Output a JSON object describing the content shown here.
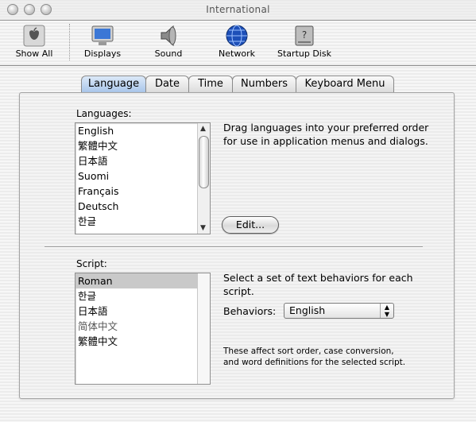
{
  "window": {
    "title": "International"
  },
  "toolbar": {
    "items": [
      {
        "label": "Show All",
        "icon": "apple-logo-icon"
      },
      {
        "label": "Displays",
        "icon": "monitor-icon"
      },
      {
        "label": "Sound",
        "icon": "speaker-icon"
      },
      {
        "label": "Network",
        "icon": "globe-icon"
      },
      {
        "label": "Startup Disk",
        "icon": "disk-icon"
      }
    ]
  },
  "tabs": [
    {
      "label": "Language",
      "active": true
    },
    {
      "label": "Date"
    },
    {
      "label": "Time"
    },
    {
      "label": "Numbers"
    },
    {
      "label": "Keyboard Menu"
    }
  ],
  "languages": {
    "label": "Languages:",
    "items": [
      "English",
      "繁體中文",
      "日本語",
      "Suomi",
      "Français",
      "Deutsch",
      "한글"
    ],
    "description": "Drag languages into your preferred order for use in application menus and dialogs.",
    "edit_button": "Edit..."
  },
  "script": {
    "label": "Script:",
    "items": [
      "Roman",
      "한글",
      "日本語",
      "简体中文",
      "繁體中文"
    ],
    "selected": "Roman",
    "description": "Select a set of text behaviors for each script.",
    "behaviors_label": "Behaviors:",
    "behaviors_value": "English",
    "note": "These affect sort order, case conversion, and word definitions for the selected script."
  }
}
